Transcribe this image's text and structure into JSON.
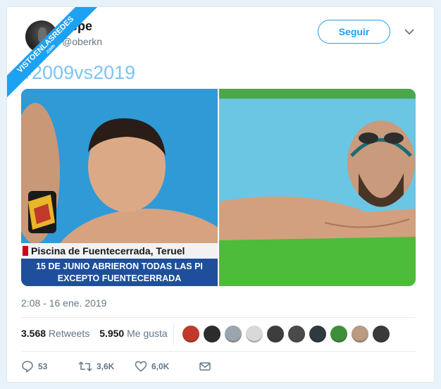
{
  "watermark": {
    "line1": "VISTOENLASREDES",
    "line2": ".com"
  },
  "tweet": {
    "author_name": "Pepe",
    "author_handle": "@oberkn",
    "follow_label": "Seguir",
    "text": "#2009vs2019",
    "timestamp": "2:08 - 16 ene. 2019"
  },
  "media": {
    "left_caption_line1": "Piscina de Fuentecerrada, Teruel",
    "left_caption_line2": "15 DE JUNIO ABRIERON TODAS LAS PI",
    "left_caption_line3": "EXCEPTO FUENTECERRADA"
  },
  "stats": {
    "retweets_count": "3.568",
    "retweets_label": "Retweets",
    "likes_count": "5.950",
    "likes_label": "Me gusta"
  },
  "liker_colors": [
    "#c0392b",
    "#2c2c2c",
    "#9aa5ad",
    "#d9d9d9",
    "#3d3d3d",
    "#4a4a4a",
    "#2f3a3f",
    "#3f8f3a",
    "#b99a82",
    "#3a3a3a"
  ],
  "actions": {
    "reply_count": "53",
    "retweet_count": "3,6K",
    "like_count": "6,0K"
  },
  "colors": {
    "accent": "#1da1f2",
    "muted": "#657786"
  }
}
